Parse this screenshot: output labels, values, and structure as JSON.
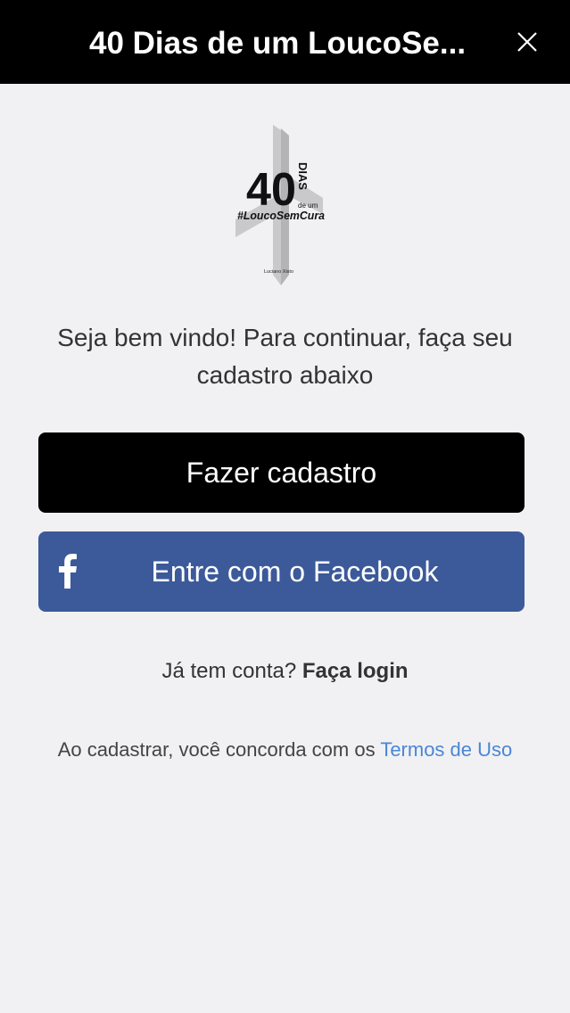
{
  "header": {
    "title": "40 Dias de um LoucoSe..."
  },
  "logo": {
    "number": "40",
    "dias": "DIAS",
    "deum": "de um",
    "hashtag": "#LoucoSemCura",
    "author": "Luciano Xisto"
  },
  "welcome": {
    "text": "Seja bem vindo! Para continuar, faça seu cadastro abaixo"
  },
  "buttons": {
    "signup_label": "Fazer cadastro",
    "facebook_label": "Entre com o Facebook"
  },
  "login": {
    "prompt": "Já tem conta?",
    "link": "Faça login"
  },
  "terms": {
    "prefix": "Ao cadastrar, você concorda com os",
    "link": "Termos de Uso"
  },
  "colors": {
    "header_bg": "#000000",
    "background": "#f1f1f3",
    "signup_bg": "#000000",
    "facebook_bg": "#3c5a9a",
    "link_blue": "#4a86d6"
  }
}
